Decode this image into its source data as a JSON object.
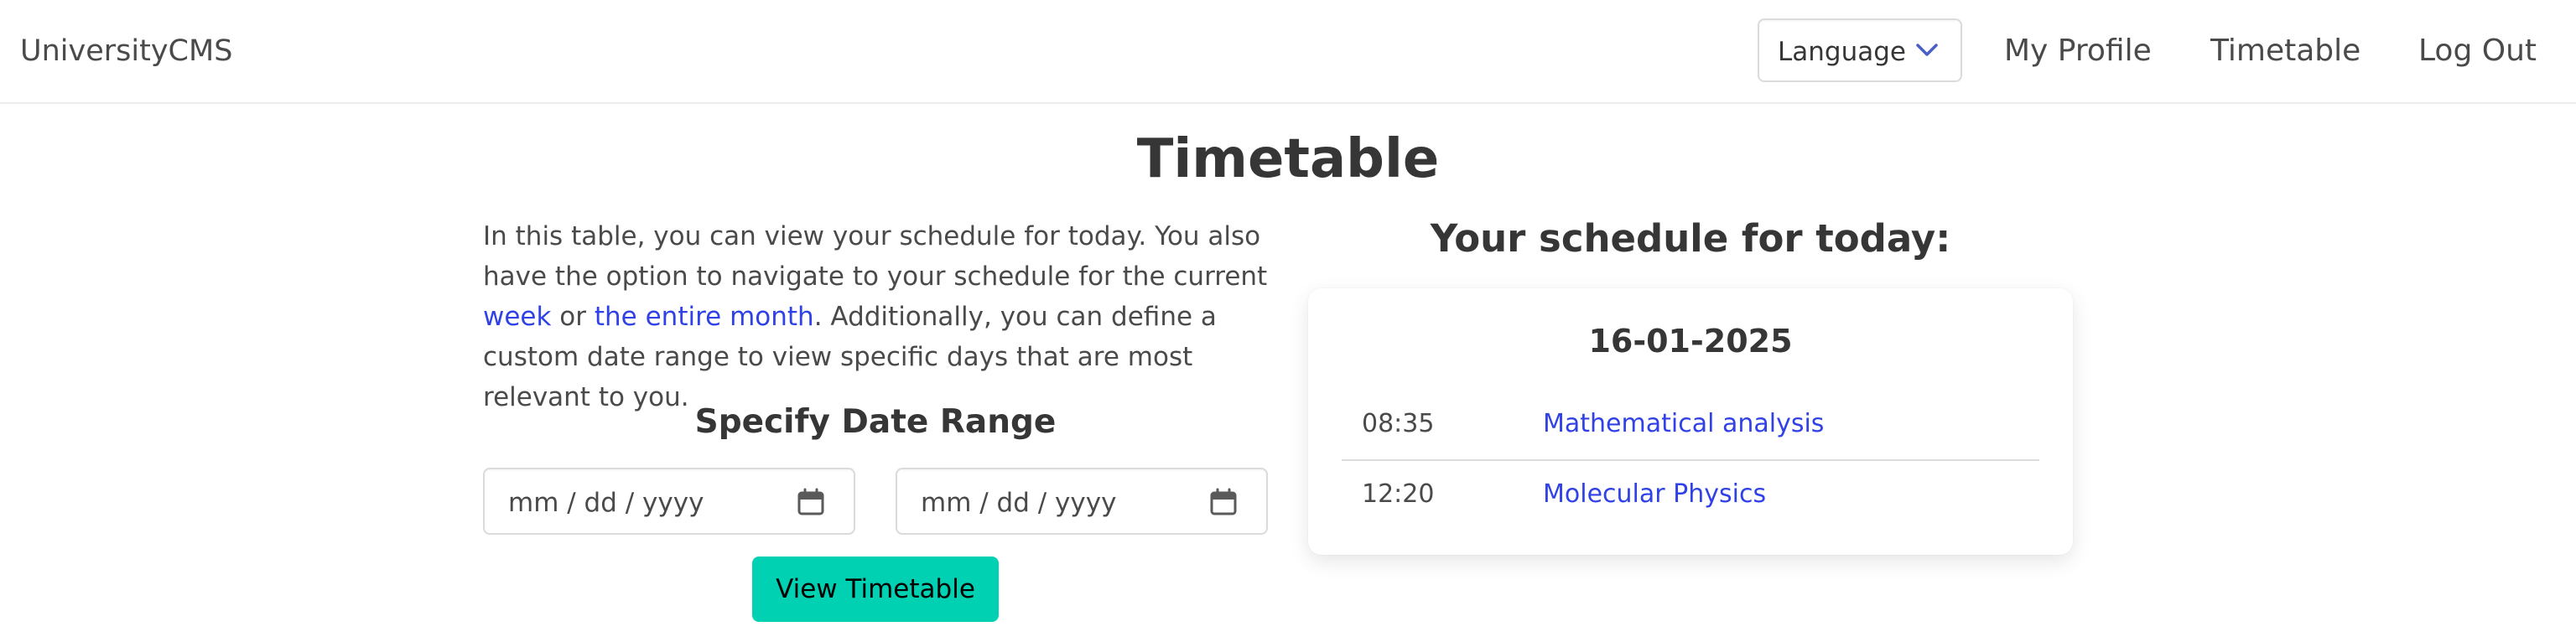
{
  "navbar": {
    "brand": "UniversityCMS",
    "language_label": "Language",
    "links": {
      "profile": "My Profile",
      "timetable": "Timetable",
      "logout": "Log Out"
    }
  },
  "main": {
    "title": "Timetable",
    "intro": {
      "part1": "In this table, you can view your schedule for today. You also have the option to navigate to your schedule for the current ",
      "week_link": "week",
      "part2": " or ",
      "month_link": "the entire month",
      "part3": ". Additionally, you can define a custom date range to view specific days that are most relevant to you."
    },
    "date_range": {
      "title": "Specify Date Range",
      "start_placeholder": "mm / dd / yyyy",
      "end_placeholder": "mm / dd / yyyy",
      "button_label": "View Timetable"
    }
  },
  "schedule": {
    "heading": "Your schedule for today:",
    "date": "16-01-2025",
    "entries": [
      {
        "time": "08:35",
        "subject": "Mathematical analysis"
      },
      {
        "time": "12:20",
        "subject": "Molecular Physics"
      }
    ]
  },
  "colors": {
    "primary_button": "#00d1b2",
    "link": "#3042e5",
    "text": "#363636",
    "border": "#dbdbdb"
  },
  "icons": {
    "language_dropdown": "chevron-down-icon",
    "date_picker": "calendar-icon"
  }
}
